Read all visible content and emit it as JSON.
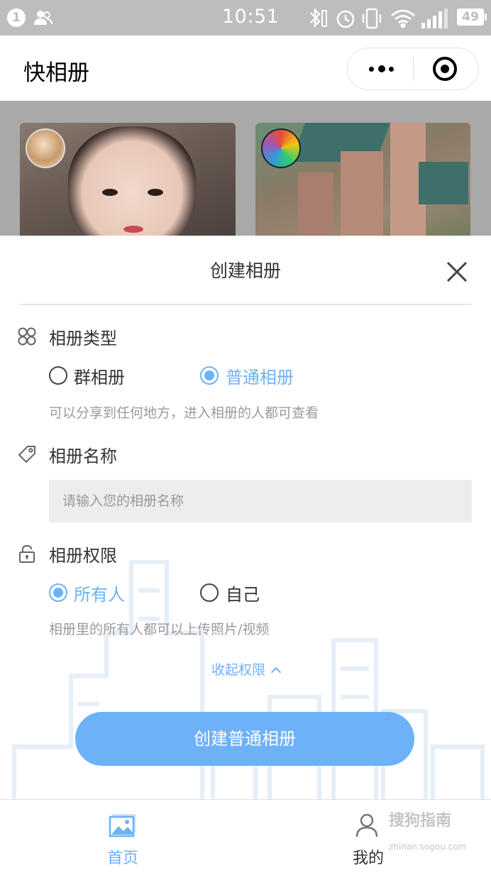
{
  "status_bar": {
    "notification_count": "1",
    "time": "10:51",
    "battery": "49"
  },
  "title_bar": {
    "title": "快相册"
  },
  "modal": {
    "title": "创建相册",
    "album_type": {
      "label": "相册类型",
      "options": [
        "群相册",
        "普通相册"
      ],
      "selected": "普通相册",
      "hint": "可以分享到任何地方，进入相册的人都可查看"
    },
    "album_name": {
      "label": "相册名称",
      "placeholder": "请输入您的相册名称",
      "value": ""
    },
    "permission": {
      "label": "相册权限",
      "options": [
        "所有人",
        "自己"
      ],
      "selected": "所有人",
      "hint": "相册里的所有人都可以上传照片/视频"
    },
    "collapse_link": "收起权限",
    "create_button": "创建普通相册"
  },
  "tab_bar": {
    "items": [
      {
        "label": "首页",
        "icon": "image-icon",
        "active": true
      },
      {
        "label": "我的",
        "icon": "user-icon",
        "active": false
      }
    ]
  },
  "watermark": {
    "text": "搜狗指南",
    "url": "zhinan.sogou.com"
  },
  "colors": {
    "accent": "#6cb2f8",
    "button": "#6db1f9",
    "status_bar": "#bdbdbd"
  }
}
